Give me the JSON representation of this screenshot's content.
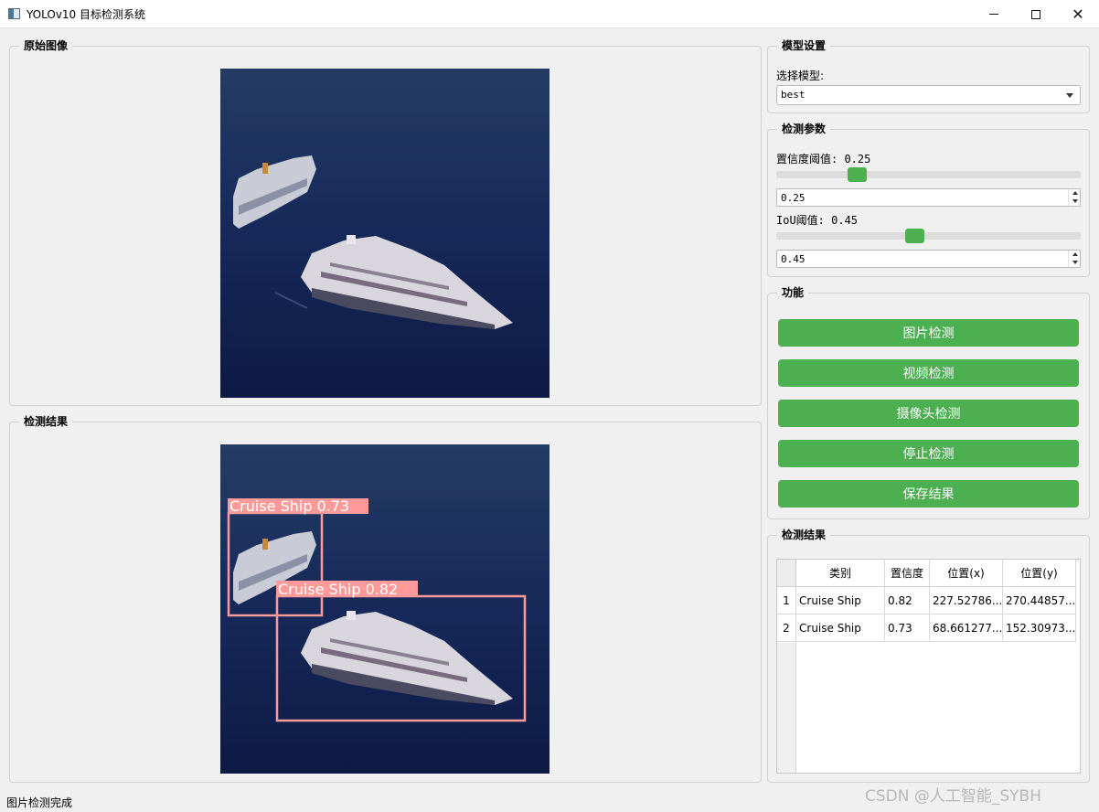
{
  "window": {
    "title": "YOLOv10 目标检测系统",
    "icons": [
      "app-icon",
      "minimize-icon",
      "maximize-icon",
      "close-icon"
    ],
    "close_glyph": "✕"
  },
  "original_panel": {
    "title": "原始图像"
  },
  "result_panel": {
    "title": "检测结果",
    "detections_overlay": [
      {
        "label": "Cruise Ship 0.73"
      },
      {
        "label": "Cruise Ship 0.82"
      }
    ]
  },
  "model_settings": {
    "title": "模型设置",
    "select_label": "选择模型:",
    "selected_model": "best"
  },
  "detect_params": {
    "title": "检测参数",
    "conf_label": "置信度阈值: 0.25",
    "conf_value": "0.25",
    "conf_fraction": 0.25,
    "iou_label": "IoU阈值: 0.45",
    "iou_value": "0.45",
    "iou_fraction": 0.45
  },
  "functions": {
    "title": "功能",
    "buttons": [
      "图片检测",
      "视频检测",
      "摄像头检测",
      "停止检测",
      "保存结果"
    ],
    "button_color": "#4caf50"
  },
  "results_table": {
    "title": "检测结果",
    "headers": [
      "类别",
      "置信度",
      "位置(x)",
      "位置(y)"
    ],
    "rows": [
      {
        "index": "1",
        "class": "Cruise Ship",
        "conf": "0.82",
        "x": "227.52786...",
        "y": "270.44857..."
      },
      {
        "index": "2",
        "class": "Cruise Ship",
        "conf": "0.73",
        "x": "68.661277...",
        "y": "152.30973..."
      }
    ]
  },
  "status": {
    "text": "图片检测完成"
  },
  "watermark": "CSDN @人工智能_SYBH",
  "colors": {
    "bbox": "#ff8a8a",
    "accent": "#4caf50",
    "sea": "#152a5a"
  }
}
